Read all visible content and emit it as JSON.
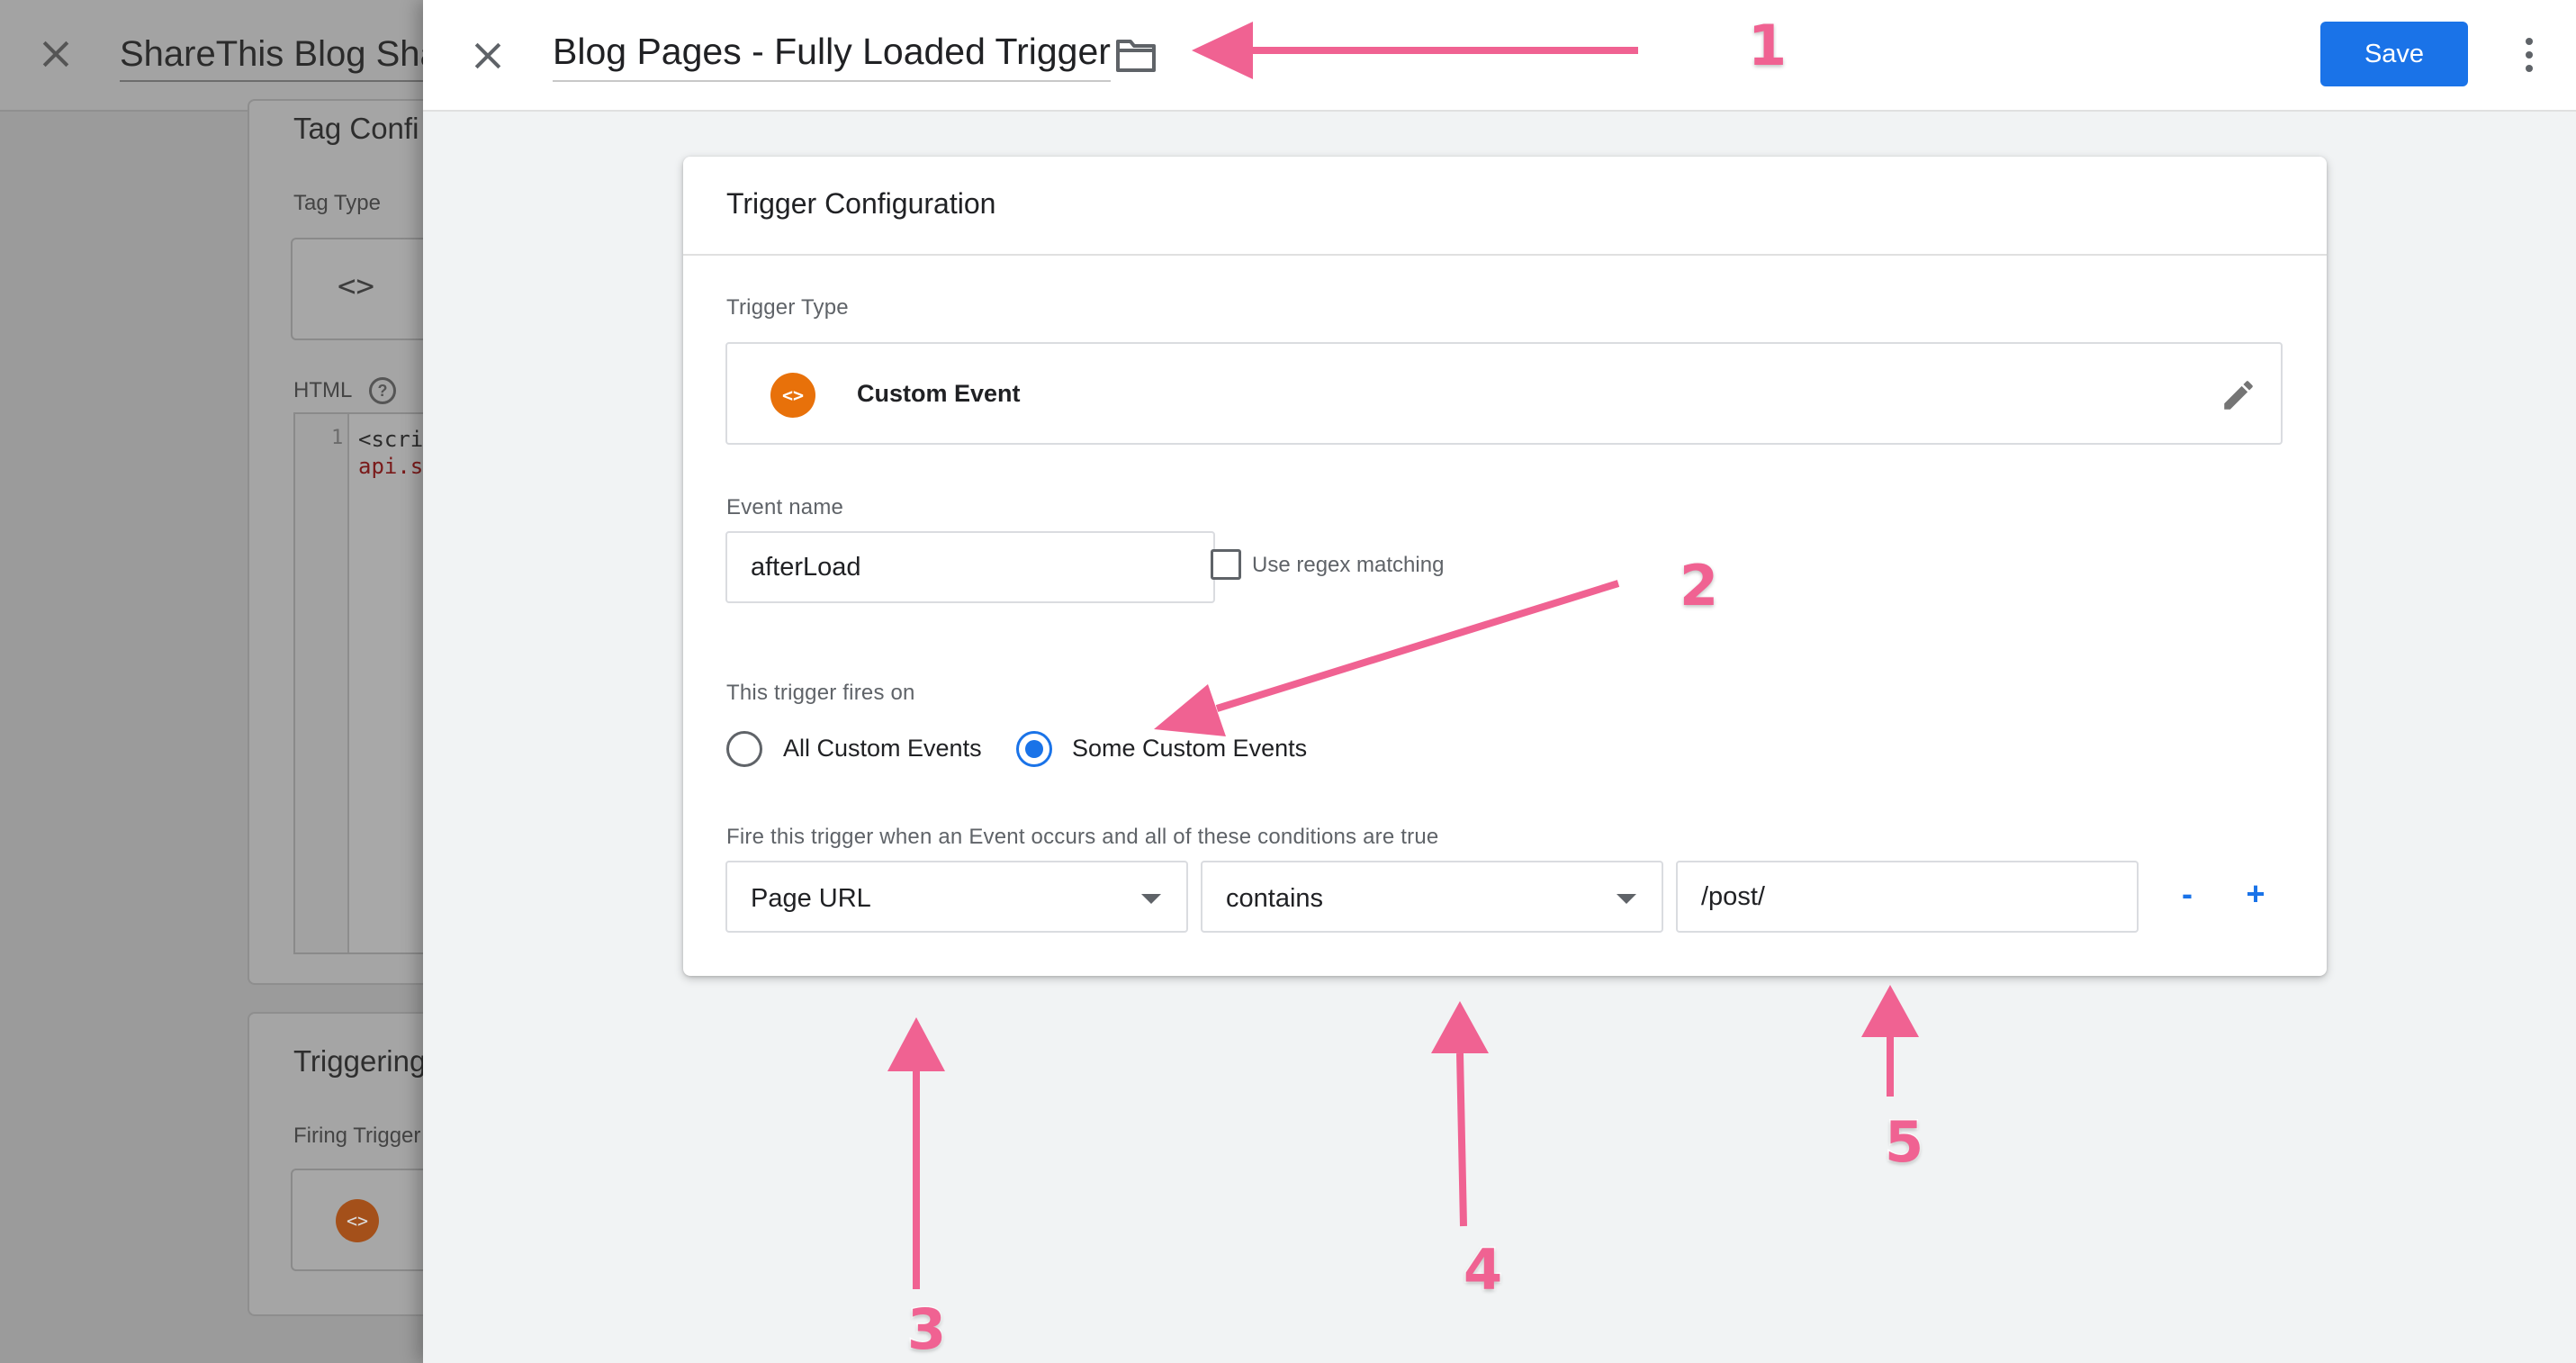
{
  "background": {
    "title": "ShareThis Blog Sha",
    "section1_heading": "Tag Confi",
    "tag_type_label": "Tag Type",
    "code_glyph": "<>",
    "html_label": "HTML",
    "help_glyph": "?",
    "line_number": "1",
    "code_line1": "<scri",
    "code_line2": "api.s",
    "section2_heading": "Triggering",
    "firing_label": "Firing Trigger",
    "trigger_icon_glyph": "<>"
  },
  "header": {
    "title": "Blog Pages - Fully Loaded Trigger",
    "save_label": "Save"
  },
  "card": {
    "title": "Trigger Configuration",
    "trigger_type_label": "Trigger Type",
    "trigger_type_icon": "<>",
    "trigger_type_name": "Custom Event",
    "event_name_label": "Event name",
    "event_name_value": "afterLoad",
    "regex_label": "Use regex matching",
    "fires_on_label": "This trigger fires on",
    "radio_all": "All Custom Events",
    "radio_some": "Some Custom Events",
    "selected_option": "Some Custom Events",
    "conditions_label": "Fire this trigger when an Event occurs and all of these conditions are true",
    "condition": {
      "variable": "Page URL",
      "operator": "contains",
      "value": "/post/",
      "remove_label": "-",
      "add_label": "+"
    }
  },
  "annotations": [
    "1",
    "2",
    "3",
    "4",
    "5"
  ],
  "colors": {
    "accent": "#1a73e8",
    "trigger_icon": "#e8710a",
    "annotation": "#f06292"
  },
  "icons": [
    "close-icon",
    "folder-icon",
    "more-vert-icon",
    "pencil-icon",
    "code-icon",
    "help-icon"
  ]
}
